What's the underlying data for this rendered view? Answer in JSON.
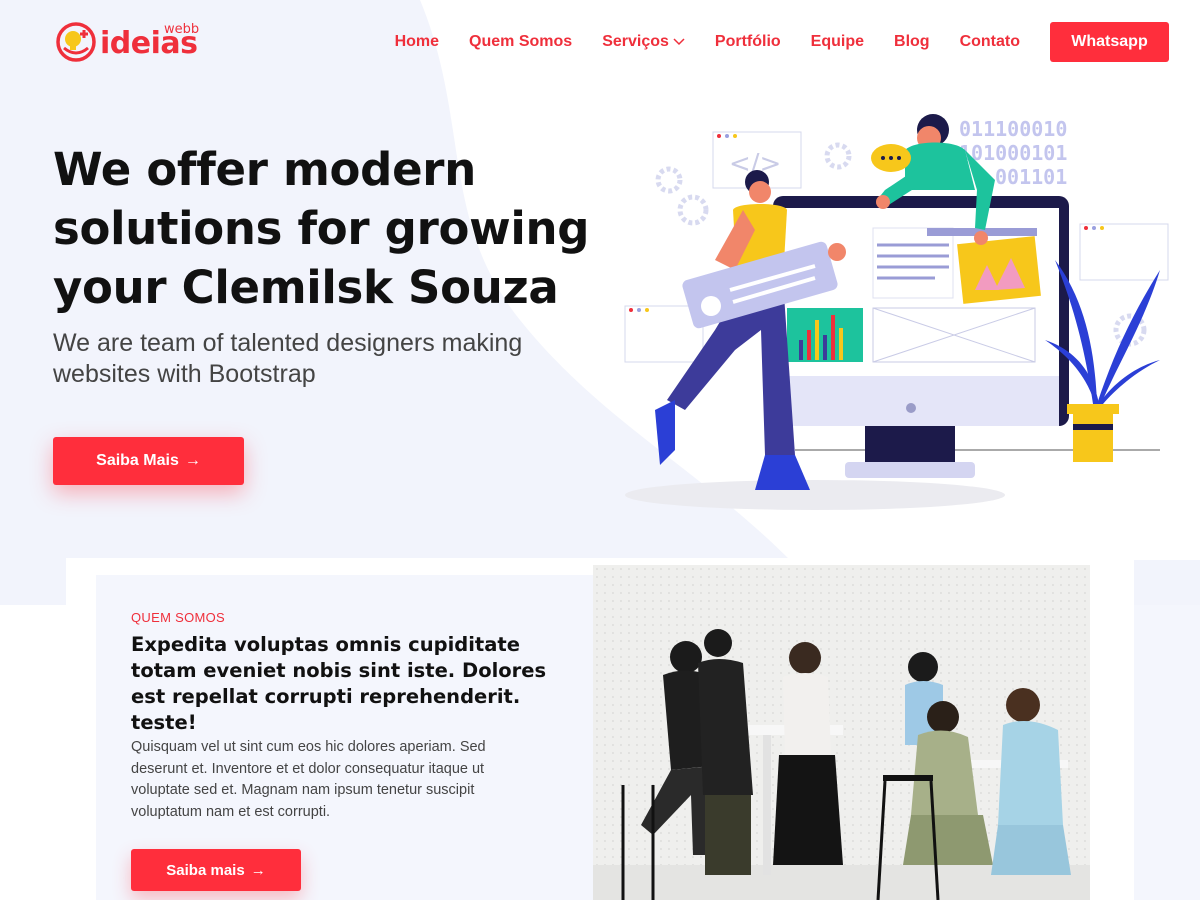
{
  "brand": {
    "name": "ideias",
    "sub": "webb"
  },
  "nav": {
    "items": [
      "Home",
      "Quem Somos",
      "Serviços",
      "Portfólio",
      "Equipe",
      "Blog",
      "Contato"
    ],
    "cta": "Whatsapp"
  },
  "hero": {
    "title_lines": [
      "We offer modern",
      "solutions for growing",
      "your Clemilsk Souza"
    ],
    "subtitle": "We are team of talented designers making websites with Bootstrap",
    "button": "Saiba Mais",
    "binary": [
      "011100010",
      "101000101",
      "001101"
    ]
  },
  "about": {
    "kicker": "QUEM SOMOS",
    "title": "Expedita voluptas omnis cupiditate totam eveniet nobis sint iste. Dolores est repellat corrupti reprehenderit. teste!",
    "text": "Quisquam vel ut sint cum eos hic dolores aperiam. Sed deserunt et. Inventore et et dolor consequatur itaque ut voluptate sed et. Magnam nam ipsum tenetur suscipit voluptatum nam et est corrupti.",
    "button": "Saiba mais"
  },
  "colors": {
    "accent": "#ff2e3c",
    "bg_soft": "#f4f6fd",
    "purple": "#3d3b9a",
    "teal": "#1dc39d",
    "yellow": "#f7c71b"
  },
  "icons": [
    "lightbulb-logo-icon",
    "chevron-down-icon",
    "arrow-right-icon"
  ]
}
